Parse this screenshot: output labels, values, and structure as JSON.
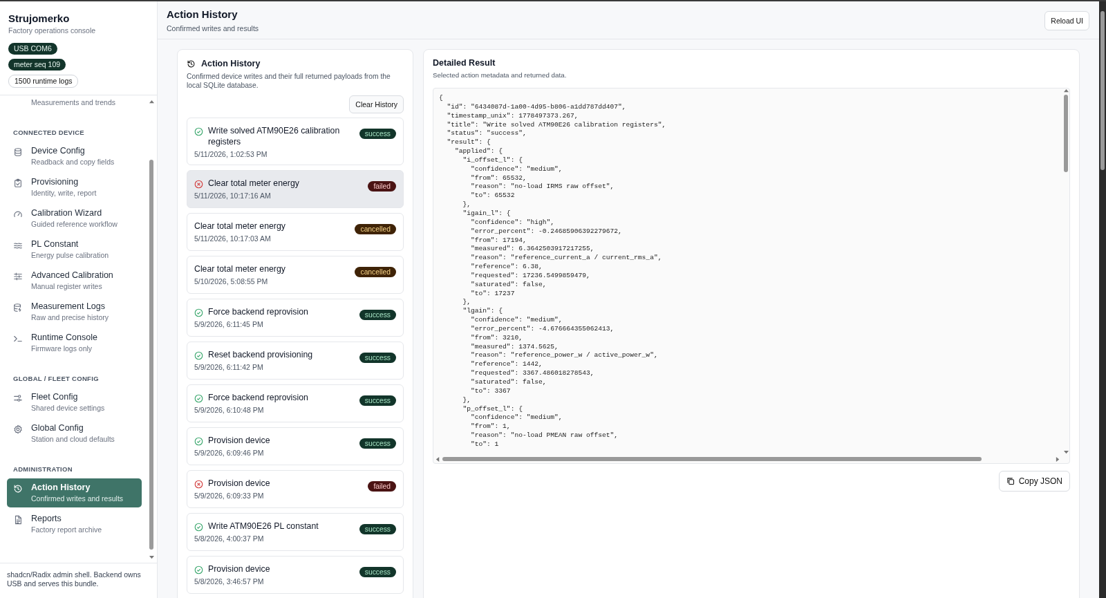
{
  "brand": {
    "title": "Strujomerko",
    "subtitle": "Factory operations console"
  },
  "badges": [
    {
      "label": "USB COM6",
      "kind": "dark"
    },
    {
      "label": "meter seq 109",
      "kind": "dark"
    },
    {
      "label": "1500 runtime logs",
      "kind": "outline"
    }
  ],
  "nav": [
    {
      "subtitle": "Measurements and trends"
    },
    {
      "section": "CONNECTED DEVICE",
      "items": [
        {
          "label": "Device Config",
          "subtitle": "Readback and copy fields",
          "selected": false
        },
        {
          "label": "Provisioning",
          "subtitle": "Identity, write, report",
          "selected": false
        },
        {
          "label": "Calibration Wizard",
          "subtitle": "Guided reference workflow",
          "selected": false
        },
        {
          "label": "PL Constant",
          "subtitle": "Energy pulse calibration",
          "selected": false
        },
        {
          "label": "Advanced Calibration",
          "subtitle": "Manual register writes",
          "selected": false
        },
        {
          "label": "Measurement Logs",
          "subtitle": "Raw and precise history",
          "selected": false
        },
        {
          "label": "Runtime Console",
          "subtitle": "Firmware logs only",
          "selected": false
        }
      ]
    },
    {
      "section": "GLOBAL / FLEET CONFIG",
      "items": [
        {
          "label": "Fleet Config",
          "subtitle": "Shared device settings",
          "selected": false
        },
        {
          "label": "Global Config",
          "subtitle": "Station and cloud defaults",
          "selected": false
        }
      ]
    },
    {
      "section": "ADMINISTRATION",
      "items": [
        {
          "label": "Action History",
          "subtitle": "Confirmed writes and results",
          "selected": true
        },
        {
          "label": "Reports",
          "subtitle": "Factory report archive",
          "selected": false
        }
      ]
    }
  ],
  "sidebar_footer": "shadcn/Radix admin shell. Backend owns USB and serves this bundle.",
  "header": {
    "title": "Action History",
    "subtitle": "Confirmed writes and results",
    "button": "Reload UI"
  },
  "history": {
    "title": "Action History",
    "description": "Confirmed device writes and their full returned payloads from the local SQLite database.",
    "button": "Clear History",
    "items": [
      {
        "title": "Write solved ATM90E26 calibration registers",
        "time": "5/11/2026, 1:02:53 PM",
        "status": "success",
        "selected": false
      },
      {
        "title": "Clear total meter energy",
        "time": "5/11/2026, 10:17:16 AM",
        "status": "failed",
        "selected": true
      },
      {
        "title": "Clear total meter energy",
        "time": "5/11/2026, 10:17:03 AM",
        "status": "cancelled",
        "selected": false
      },
      {
        "title": "Clear total meter energy",
        "time": "5/10/2026, 5:08:55 PM",
        "status": "cancelled",
        "selected": false
      },
      {
        "title": "Force backend reprovision",
        "time": "5/9/2026, 6:11:45 PM",
        "status": "success",
        "selected": false
      },
      {
        "title": "Reset backend provisioning",
        "time": "5/9/2026, 6:11:42 PM",
        "status": "success",
        "selected": false
      },
      {
        "title": "Force backend reprovision",
        "time": "5/9/2026, 6:10:48 PM",
        "status": "success",
        "selected": false
      },
      {
        "title": "Provision device",
        "time": "5/9/2026, 6:09:46 PM",
        "status": "success",
        "selected": false
      },
      {
        "title": "Provision device",
        "time": "5/9/2026, 6:09:33 PM",
        "status": "failed",
        "selected": false
      },
      {
        "title": "Write ATM90E26 PL constant",
        "time": "5/8/2026, 4:00:37 PM",
        "status": "success",
        "selected": false
      },
      {
        "title": "Provision device",
        "time": "5/8/2026, 3:46:57 PM",
        "status": "success",
        "selected": false
      }
    ]
  },
  "detail": {
    "title": "Detailed Result",
    "subtitle": "Selected action metadata and returned data.",
    "button": "Copy JSON",
    "json_lines": [
      "{",
      "  \"id\": \"6434087d-1a00-4d95-b806-a1dd787dd407\",",
      "  \"timestamp_unix\": 1778497373.267,",
      "  \"title\": \"Write solved ATM90E26 calibration registers\",",
      "  \"status\": \"success\",",
      "  \"result\": {",
      "    \"applied\": {",
      "      \"i_offset_l\": {",
      "        \"confidence\": \"medium\",",
      "        \"from\": 65532,",
      "        \"reason\": \"no-load IRMS raw offset\",",
      "        \"to\": 65532",
      "      },",
      "      \"igain_l\": {",
      "        \"confidence\": \"high\",",
      "        \"error_percent\": -0.24685906392279672,",
      "        \"from\": 17194,",
      "        \"measured\": 6.3642503917217255,",
      "        \"reason\": \"reference_current_a / current_rms_a\",",
      "        \"reference\": 6.38,",
      "        \"requested\": 17236.5499859479,",
      "        \"saturated\": false,",
      "        \"to\": 17237",
      "      },",
      "      \"lgain\": {",
      "        \"confidence\": \"medium\",",
      "        \"error_percent\": -4.676664355062413,",
      "        \"from\": 3210,",
      "        \"measured\": 1374.5625,",
      "        \"reason\": \"reference_power_w / active_power_w\",",
      "        \"reference\": 1442,",
      "        \"requested\": 3367.486018278543,",
      "        \"saturated\": false,",
      "        \"to\": 3367",
      "      },",
      "      \"p_offset_l\": {",
      "        \"confidence\": \"medium\",",
      "        \"from\": 1,",
      "        \"reason\": \"no-load PMEAN raw offset\",",
      "        \"to\": 1"
    ]
  }
}
